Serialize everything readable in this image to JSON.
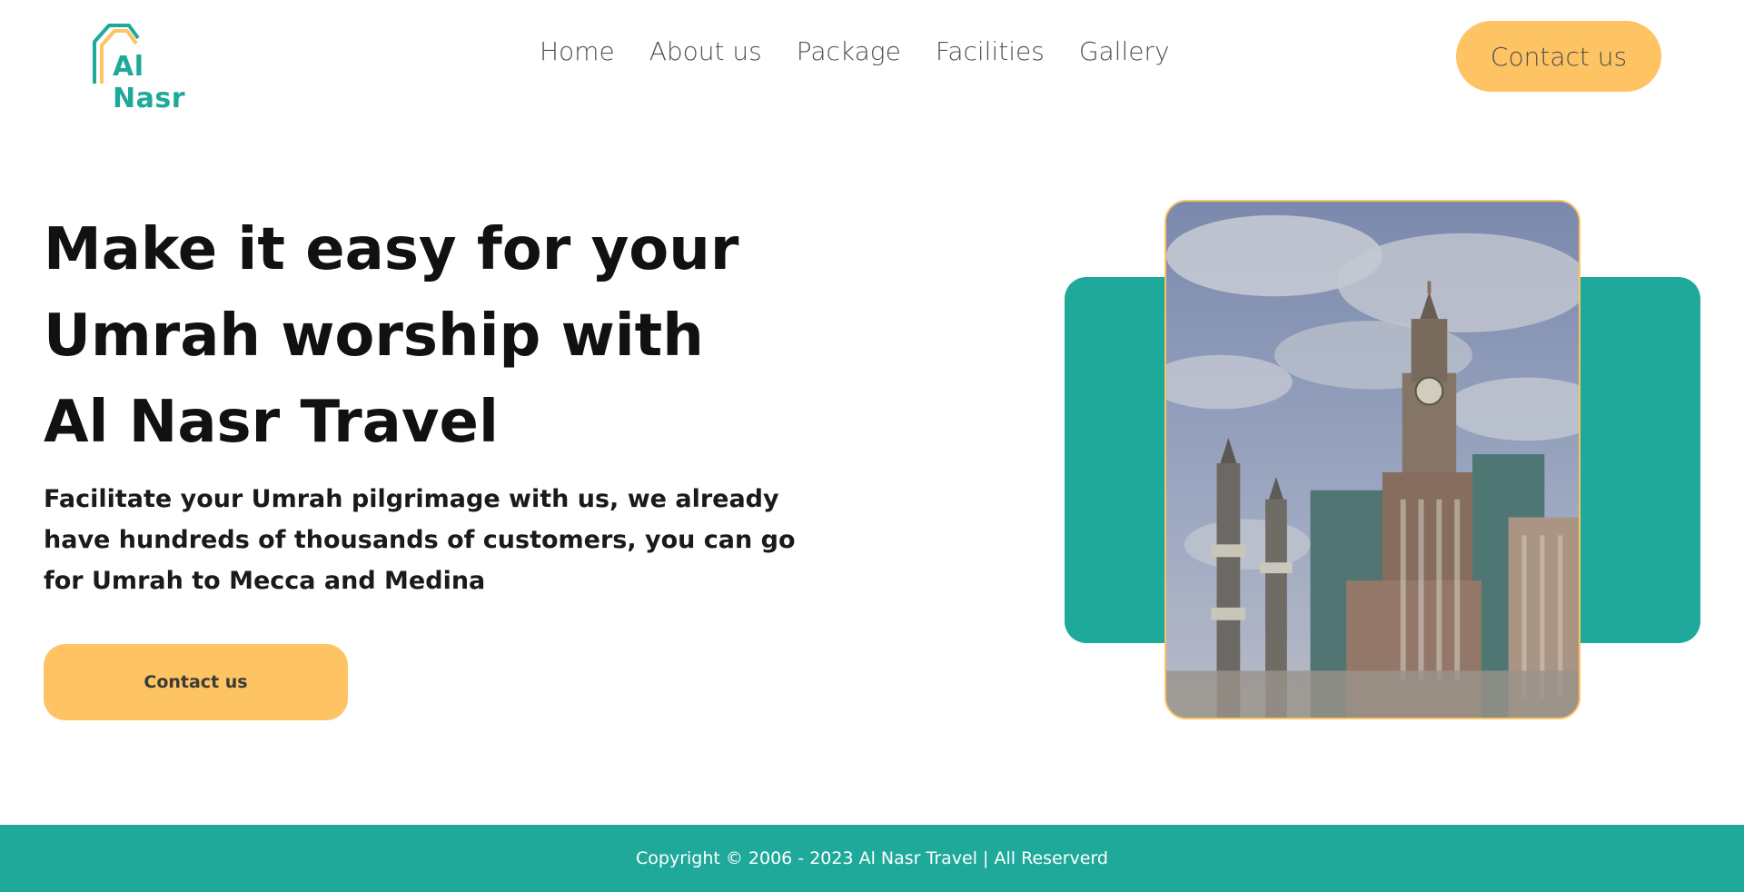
{
  "brand": {
    "name": "Al Nasr",
    "primary_color": "#1ea99a",
    "accent_color": "#fec362"
  },
  "nav": {
    "items": [
      {
        "label": "Home"
      },
      {
        "label": "About us"
      },
      {
        "label": "Package"
      },
      {
        "label": "Facilities"
      },
      {
        "label": "Gallery"
      }
    ],
    "cta_label": "Contact us"
  },
  "hero": {
    "title": "Make it easy for your Umrah worship with Al Nasr Travel",
    "subtitle": "Facilitate your Umrah pilgrimage with us, we already have hundreds of thousands of customers, you can go for Umrah to Mecca and Medina",
    "cta_label": "Contact us",
    "image_icon": "mecca-clock-tower-photo"
  },
  "footer": {
    "copyright": "Copyright © 2006 - 2023 Al Nasr Travel | All Reserverd"
  }
}
